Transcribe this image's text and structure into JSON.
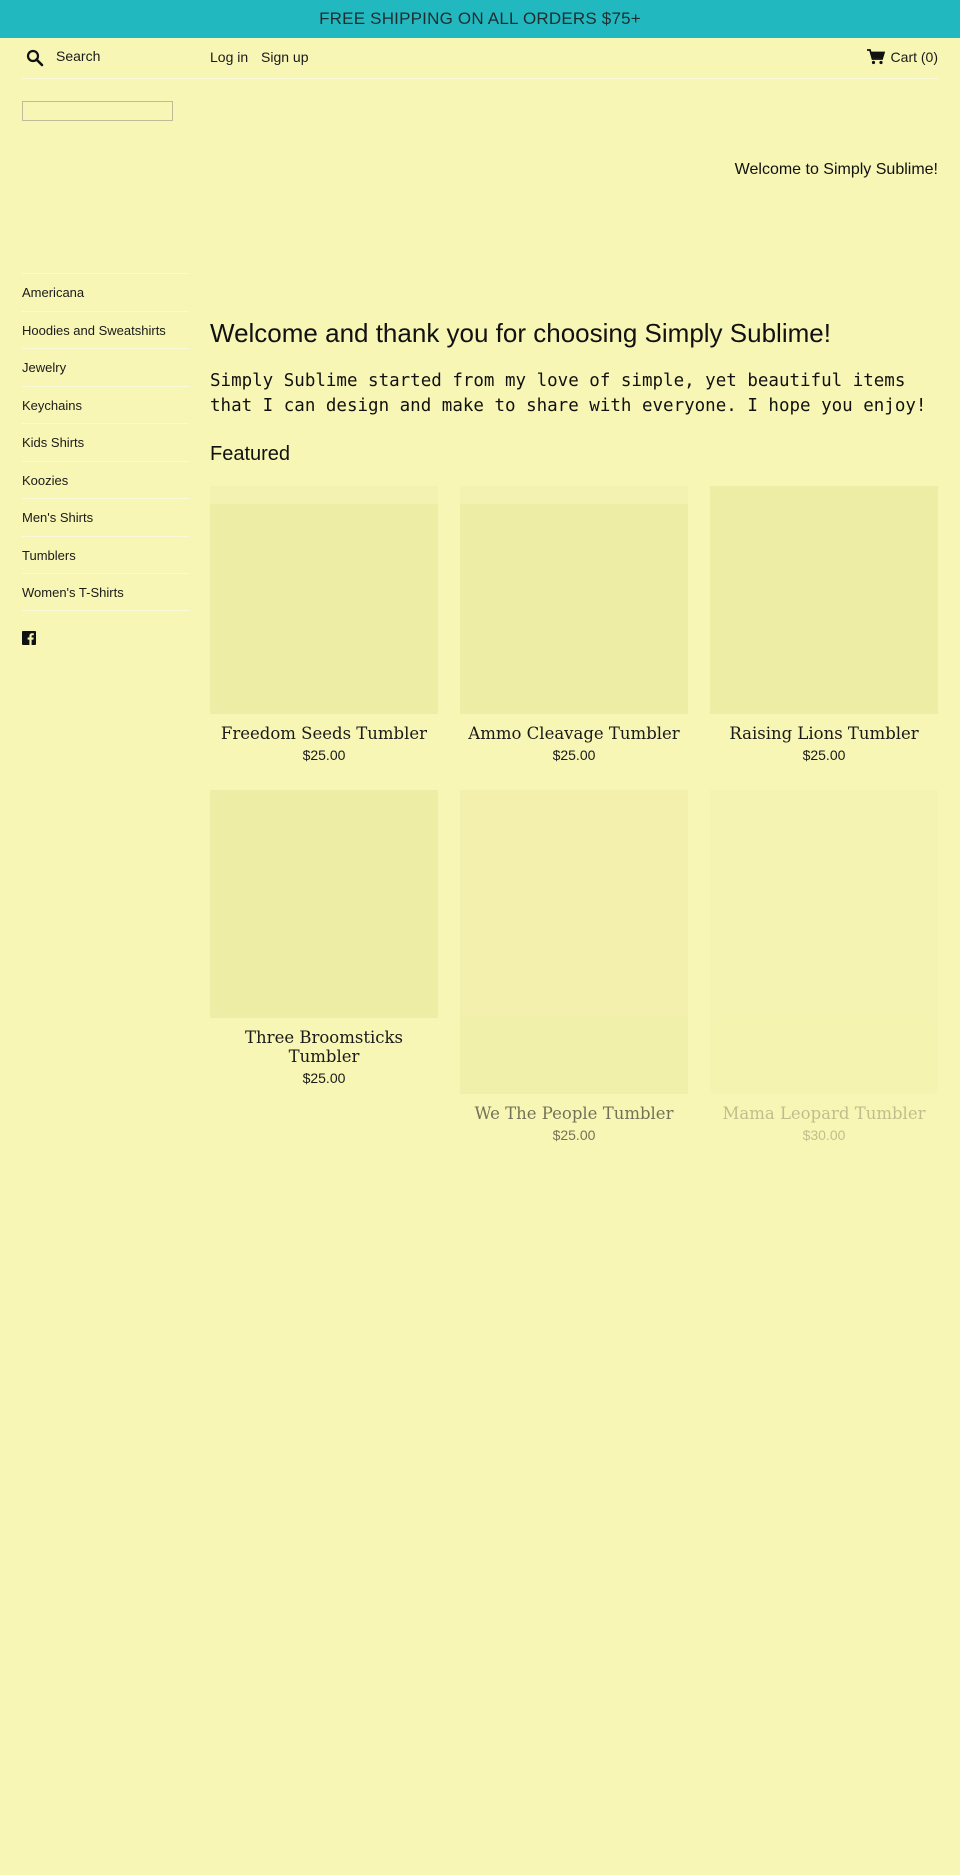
{
  "announcement": {
    "text": "FREE SHIPPING ON ALL ORDERS $75+"
  },
  "header": {
    "search_label": "Search",
    "login_label": "Log in",
    "signup_label": "Sign up",
    "cart_label": "Cart (0)"
  },
  "banner": {
    "welcome": "Welcome to Simply Sublime!"
  },
  "sidebar": {
    "items": [
      {
        "label": "Americana"
      },
      {
        "label": "Hoodies and Sweatshirts"
      },
      {
        "label": "Jewelry"
      },
      {
        "label": "Keychains"
      },
      {
        "label": "Kids Shirts"
      },
      {
        "label": "Koozies"
      },
      {
        "label": "Men's Shirts"
      },
      {
        "label": "Tumblers"
      },
      {
        "label": "Women's T-Shirts"
      }
    ],
    "social_icon": "facebook-icon"
  },
  "main": {
    "title": "Welcome and thank you for choosing Simply Sublime!",
    "intro": "Simply Sublime started from my love of simple, yet beautiful items that I can design and make to share with everyone. I hope you enjoy!",
    "featured_title": "Featured",
    "products": [
      {
        "name": "Freedom Seeds Tumbler",
        "price": "$25.00"
      },
      {
        "name": "Ammo Cleavage Tumbler",
        "price": "$25.00"
      },
      {
        "name": "Raising Lions Tumbler",
        "price": "$25.00"
      },
      {
        "name": "Three Broomsticks Tumbler",
        "price": "$25.00"
      },
      {
        "name": "We The People Tumbler",
        "price": "$25.00"
      },
      {
        "name": "Mama Leopard Tumbler",
        "price": "$30.00"
      }
    ]
  },
  "colors": {
    "background": "#f7f6b4",
    "announcement_bar": "#22b8c0",
    "image_placeholder": "#eeeda6"
  }
}
